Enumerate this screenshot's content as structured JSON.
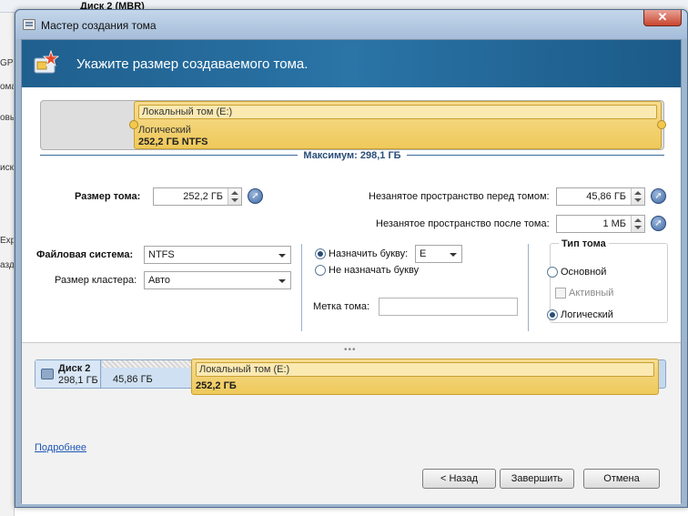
{
  "background": {
    "disk_title": "Диск 2 (MBR)",
    "left_fragments": [
      "GPT",
      "ома",
      "овы",
      "иск",
      "Exp",
      "азд"
    ]
  },
  "window": {
    "title": "Мастер создания тома",
    "close_label": "✕"
  },
  "header": {
    "text": "Укажите размер создаваемого тома."
  },
  "partition_preview": {
    "volume_name": "Локальный том (E:)",
    "type": "Логический",
    "size_fs": "252,2 ГБ NTFS",
    "max_label": "Максимум: 298,1 ГБ"
  },
  "size": {
    "volume_size_label": "Размер тома:",
    "volume_size_value": "252,2 ГБ",
    "before_label": "Незанятое пространство перед томом:",
    "before_value": "45,86 ГБ",
    "after_label": "Незанятое пространство после тома:",
    "after_value": "1 МБ"
  },
  "format": {
    "fs_label": "Файловая система:",
    "fs_value": "NTFS",
    "cluster_label": "Размер кластера:",
    "cluster_value": "Авто"
  },
  "letter": {
    "assign_label": "Назначить букву:",
    "assign_value": "E",
    "no_assign_label": "Не назначать букву",
    "assign_selected": true,
    "volume_label_label": "Метка тома:",
    "volume_label_value": ""
  },
  "volume_type": {
    "group_title": "Тип тома",
    "primary_label": "Основной",
    "active_label": "Активный",
    "logical_label": "Логический",
    "selected": "logical"
  },
  "disk_map": {
    "disk_name": "Диск 2",
    "disk_size": "298,1 ГБ",
    "unallocated_size": "45,86 ГБ",
    "volume_name": "Локальный том (E:)",
    "volume_size": "252,2 ГБ"
  },
  "more_link": "Подробнее",
  "buttons": {
    "back": "< Назад",
    "finish": "Завершить",
    "cancel": "Отмена"
  },
  "colors": {
    "header_band": "#2a74a6",
    "volume_fill": "#efc95a",
    "link": "#1e57b5"
  },
  "icons": [
    "wizard-icon",
    "arrow-icon",
    "disk-icon",
    "window-icon"
  ]
}
